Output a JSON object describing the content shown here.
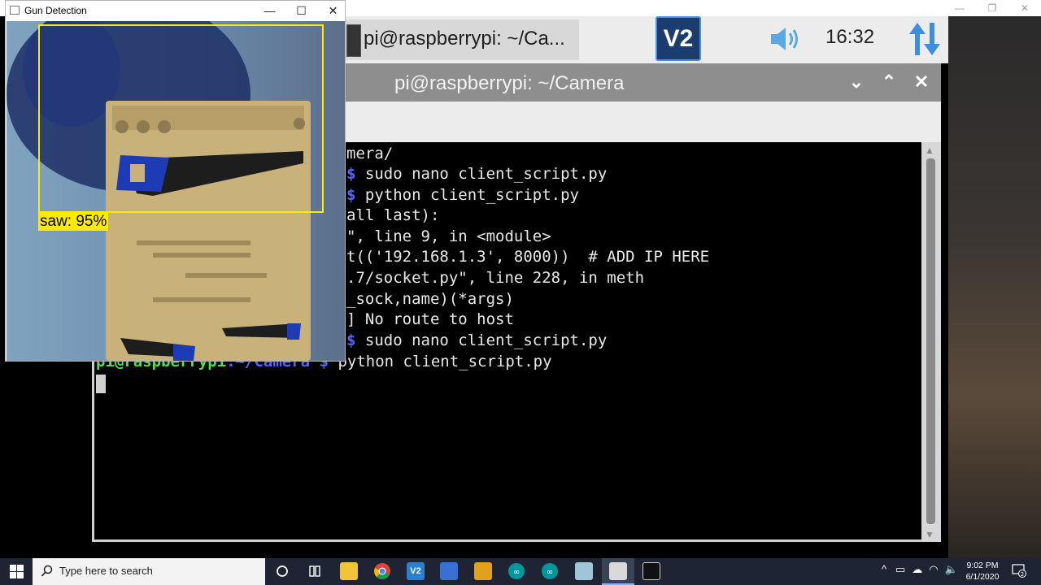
{
  "host_window": {
    "controls": [
      "—",
      "❐",
      "✕"
    ]
  },
  "pi_panel": {
    "task_label": "pi@raspberrypi: ~/Ca...",
    "vnc_label": "V2",
    "clock": "16:32"
  },
  "terminal": {
    "title": "pi@raspberrypi: ~/Camera",
    "buttons": [
      "⌄",
      "⌃",
      "✕"
    ],
    "lines": [
      {
        "dollar": "",
        "text": "mera/"
      },
      {
        "dollar": "$",
        "text": " sudo nano client_script.py"
      },
      {
        "dollar": "$",
        "text": " python client_script.py"
      },
      {
        "dollar": "",
        "text": "all last):"
      },
      {
        "dollar": "",
        "text": "\", line 9, in <module>"
      },
      {
        "dollar": "",
        "text": "t(('192.168.1.3', 8000))  # ADD IP HERE"
      },
      {
        "dollar": "",
        "text": ".7/socket.py\", line 228, in meth"
      },
      {
        "dollar": "",
        "text": "_sock,name)(*args)"
      },
      {
        "dollar": "",
        "text": "] No route to host"
      },
      {
        "dollar": "$",
        "text": " sudo nano client_script.py"
      }
    ],
    "last_prompt": {
      "user": "pi@raspberrypi",
      "path": ":~/Camera",
      "dollar": " $",
      "command": " python client_script.py"
    }
  },
  "gun_detection": {
    "title": "Gun Detection",
    "controls": [
      "—",
      "☐",
      "✕"
    ],
    "detection_label": "saw: 95%"
  },
  "taskbar": {
    "search_placeholder": "Type here to search",
    "time": "9:02 PM",
    "date": "6/1/2020",
    "tray_arrow": "^",
    "notification_count": "2"
  },
  "colors": {
    "detect_box": "#ffea00",
    "prompt_green": "#4fe04f",
    "prompt_blue": "#5a63ff",
    "taskbar_bg": "#1e2433"
  }
}
